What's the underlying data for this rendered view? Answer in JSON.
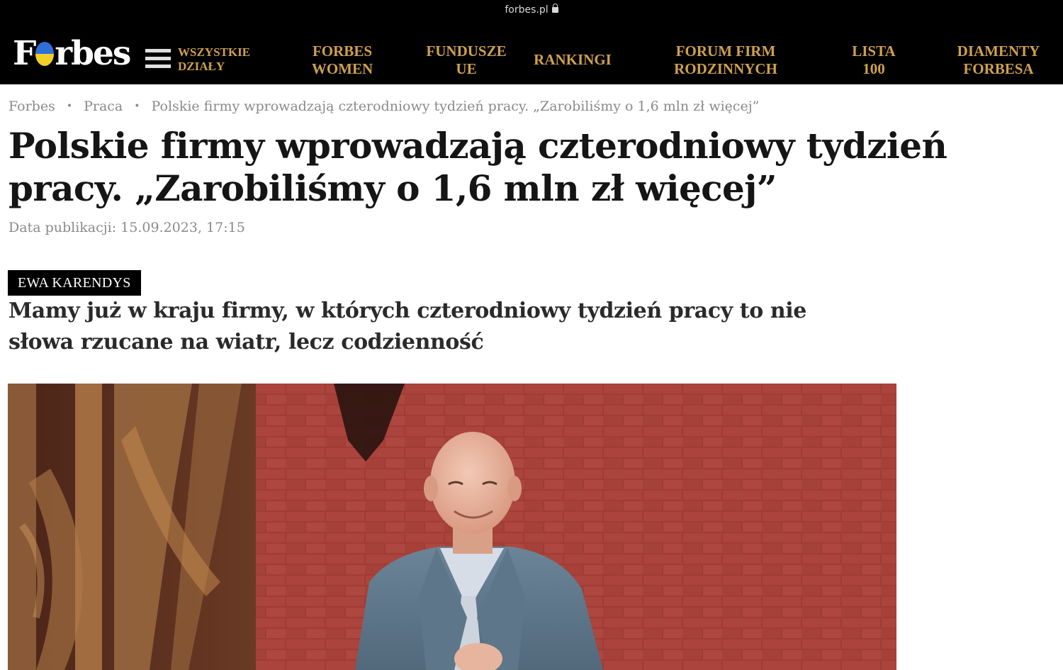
{
  "browser": {
    "url": "forbes.pl",
    "lock_icon": "lock-icon"
  },
  "nav": {
    "logo": {
      "pre": "F",
      "post": "rbes"
    },
    "menu_label": "WSZYSTKIE DZIAŁY",
    "links": [
      {
        "label": "FORBES\nWOMEN"
      },
      {
        "label": "FUNDUSZE\nUE"
      },
      {
        "label": "RANKINGI"
      },
      {
        "label": "FORUM FIRM\nRODZINNYCH"
      },
      {
        "label": "LISTA\n100"
      },
      {
        "label": "DIAMENTY\nFORBESA"
      }
    ],
    "accent_color": "#cfa14d"
  },
  "breadcrumb": {
    "items": [
      "Forbes",
      "Praca",
      "Polskie firmy wprowadzają czterodniowy tydzień pracy. „Zarobiliśmy o 1,6 mln zł więcej”"
    ],
    "separator": "•"
  },
  "article": {
    "title": "Polskie firmy wprowadzają czterodniowy tydzień pracy. „Zarobiliśmy o 1,6 mln zł więcej”",
    "published": "Data publikacji: 15.09.2023, 17:15",
    "author": "EWA KARENDYS",
    "lead": "Mamy już w kraju firmy, w których czterodniowy tydzień pracy to nie słowa rzucane na wiatr, lecz codzienność"
  }
}
